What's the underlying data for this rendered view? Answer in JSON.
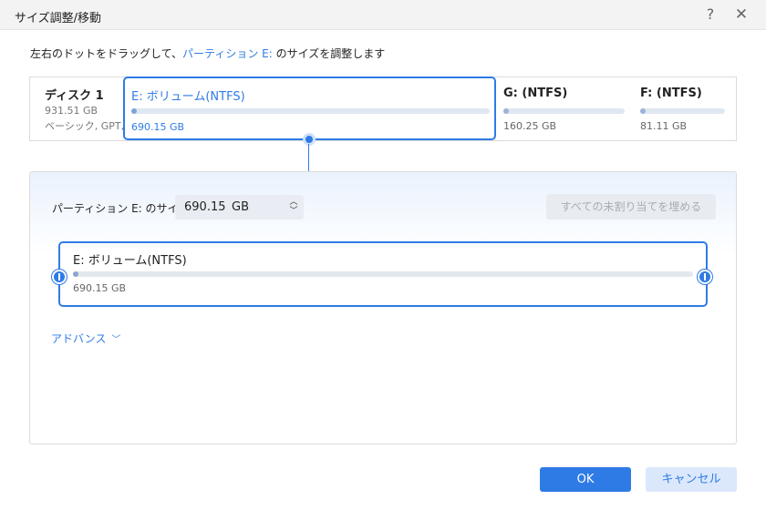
{
  "window": {
    "title": "サイズ調整/移動",
    "help_icon": "?",
    "close_icon": "✕"
  },
  "instruction": {
    "prefix": "左右のドットをドラッグして、",
    "highlight": "パーティション E:",
    "suffix": " のサイズを調整します"
  },
  "disk": {
    "name": "ディスク 1",
    "size": "931.51 GB",
    "type": "ベーシック, GPT,..."
  },
  "partitions": [
    {
      "label": "E: ボリューム(NTFS)",
      "size": "690.15 GB",
      "selected": true
    },
    {
      "label": "G: (NTFS)",
      "size": "160.25 GB",
      "selected": false
    },
    {
      "label": "F: (NTFS)",
      "size": "81.11 GB",
      "selected": false
    }
  ],
  "resize": {
    "size_label": "パーティション E: のサイズ",
    "size_value": "690.15",
    "size_unit": "GB",
    "fill_button": "すべての未割り当てを埋める",
    "partition_label": "E: ボリューム(NTFS)",
    "partition_size": "690.15 GB"
  },
  "advanced": {
    "label": "アドバンス",
    "icon": "chevron-down-icon"
  },
  "buttons": {
    "ok": "OK",
    "cancel": "キャンセル"
  },
  "colors": {
    "accent": "#2f7be6",
    "disabled_text": "#a8adb5"
  }
}
